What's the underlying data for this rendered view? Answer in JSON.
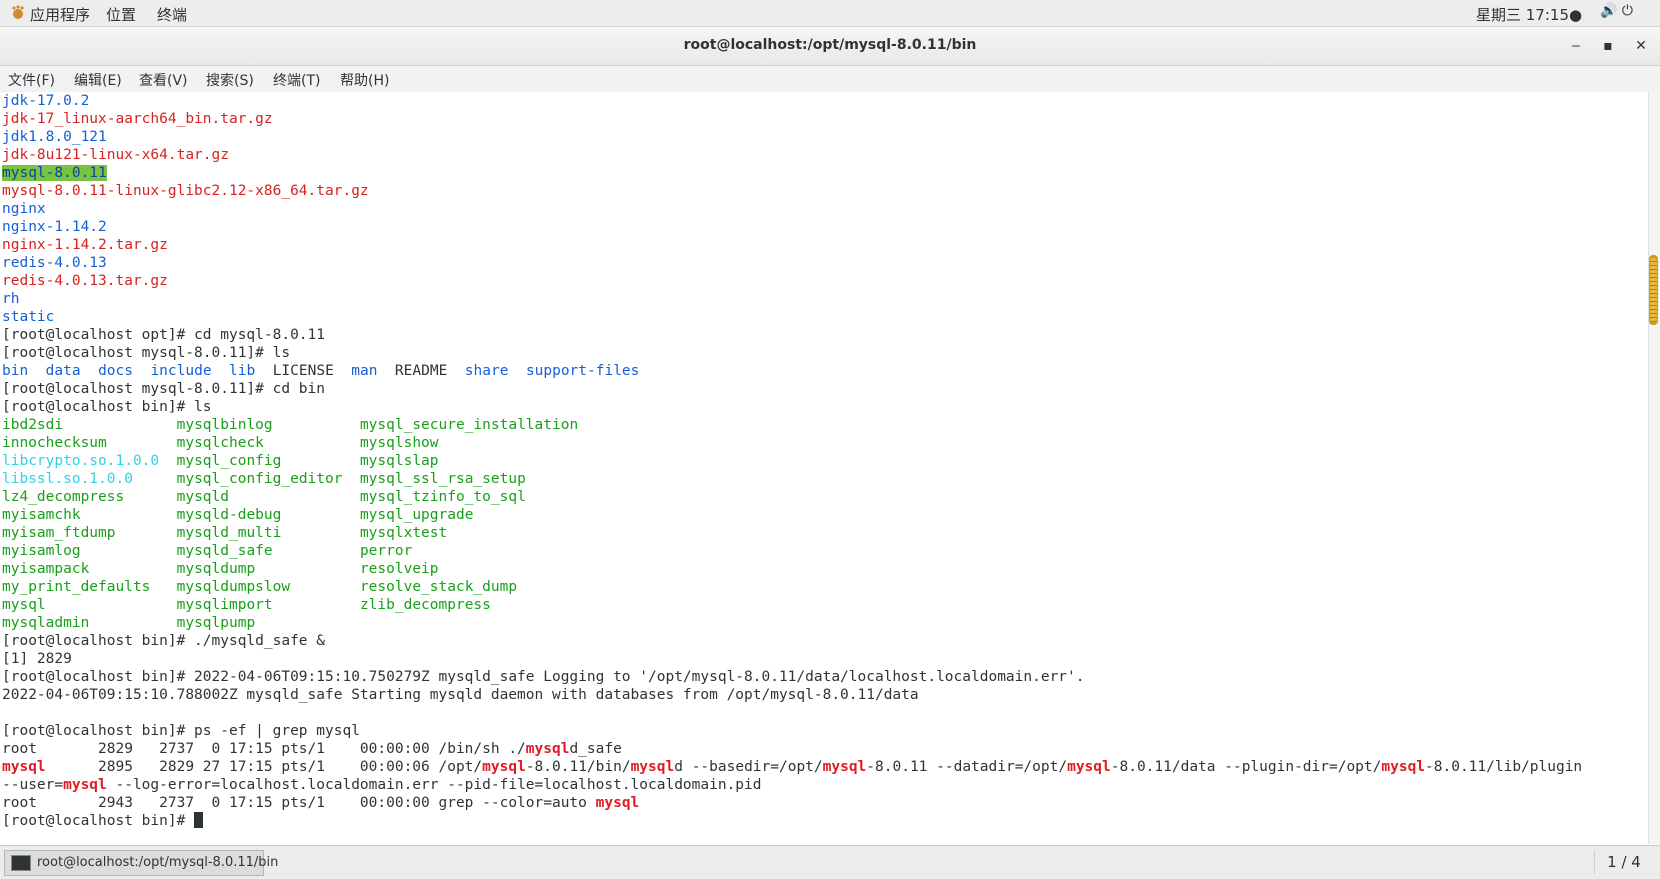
{
  "topbar": {
    "menu": [
      "应用程序",
      "位置",
      "终端"
    ],
    "clock": "星期三 17:15●",
    "status_icons": "🔊 ⏻"
  },
  "window": {
    "title": "root@localhost:/opt/mysql-8.0.11/bin",
    "minimize": "‒",
    "maximize": "▪",
    "close": "✕"
  },
  "menubar": [
    "文件(F)",
    "编辑(E)",
    "查看(V)",
    "搜索(S)",
    "终端(T)",
    "帮助(H)"
  ],
  "terminal": {
    "lines": [
      [
        {
          "t": "jdk-17.0.2",
          "c": "blue"
        }
      ],
      [
        {
          "t": "jdk-17_linux-aarch64_bin.tar.gz",
          "c": "red"
        }
      ],
      [
        {
          "t": "jdk1.8.0_121",
          "c": "blue"
        }
      ],
      [
        {
          "t": "jdk-8u121-linux-x64.tar.gz",
          "c": "red"
        }
      ],
      [
        {
          "t": "mysql-8.0.11",
          "c": "hl"
        }
      ],
      [
        {
          "t": "mysql-8.0.11-linux-glibc2.12-x86_64.tar.gz",
          "c": "red"
        }
      ],
      [
        {
          "t": "nginx",
          "c": "blue"
        }
      ],
      [
        {
          "t": "nginx-1.14.2",
          "c": "blue"
        }
      ],
      [
        {
          "t": "nginx-1.14.2.tar.gz",
          "c": "red"
        }
      ],
      [
        {
          "t": "redis-4.0.13",
          "c": "blue"
        }
      ],
      [
        {
          "t": "redis-4.0.13.tar.gz",
          "c": "red"
        }
      ],
      [
        {
          "t": "rh",
          "c": "blue"
        }
      ],
      [
        {
          "t": "static",
          "c": "blue"
        }
      ],
      [
        {
          "t": "[root@localhost opt]# cd mysql-8.0.11"
        }
      ],
      [
        {
          "t": "[root@localhost mysql-8.0.11]# ls"
        }
      ],
      [
        {
          "t": "bin",
          "c": "blue"
        },
        {
          "t": "  "
        },
        {
          "t": "data",
          "c": "blue"
        },
        {
          "t": "  "
        },
        {
          "t": "docs",
          "c": "blue"
        },
        {
          "t": "  "
        },
        {
          "t": "include",
          "c": "blue"
        },
        {
          "t": "  "
        },
        {
          "t": "lib",
          "c": "blue"
        },
        {
          "t": "  LICENSE  "
        },
        {
          "t": "man",
          "c": "blue"
        },
        {
          "t": "  README  "
        },
        {
          "t": "share",
          "c": "blue"
        },
        {
          "t": "  "
        },
        {
          "t": "support-files",
          "c": "blue"
        }
      ],
      [
        {
          "t": "[root@localhost mysql-8.0.11]# cd bin"
        }
      ],
      [
        {
          "t": "[root@localhost bin]# ls"
        }
      ],
      [
        {
          "t": "ibd2sdi             ",
          "c": "green"
        },
        {
          "t": "mysqlbinlog          ",
          "c": "green"
        },
        {
          "t": "mysql_secure_installation",
          "c": "green"
        }
      ],
      [
        {
          "t": "innochecksum        ",
          "c": "green"
        },
        {
          "t": "mysqlcheck           ",
          "c": "green"
        },
        {
          "t": "mysqlshow",
          "c": "green"
        }
      ],
      [
        {
          "t": "libcrypto.so.1.0.0",
          "c": "cyan"
        },
        {
          "t": "  "
        },
        {
          "t": "mysql_config         ",
          "c": "green"
        },
        {
          "t": "mysqlslap",
          "c": "green"
        }
      ],
      [
        {
          "t": "libssl.so.1.0.0",
          "c": "cyan"
        },
        {
          "t": "     "
        },
        {
          "t": "mysql_config_editor  ",
          "c": "green"
        },
        {
          "t": "mysql_ssl_rsa_setup",
          "c": "green"
        }
      ],
      [
        {
          "t": "lz4_decompress      ",
          "c": "green"
        },
        {
          "t": "mysqld               ",
          "c": "green"
        },
        {
          "t": "mysql_tzinfo_to_sql",
          "c": "green"
        }
      ],
      [
        {
          "t": "myisamchk           ",
          "c": "green"
        },
        {
          "t": "mysqld-debug         ",
          "c": "green"
        },
        {
          "t": "mysql_upgrade",
          "c": "green"
        }
      ],
      [
        {
          "t": "myisam_ftdump       ",
          "c": "green"
        },
        {
          "t": "mysqld_multi         ",
          "c": "green"
        },
        {
          "t": "mysqlxtest",
          "c": "green"
        }
      ],
      [
        {
          "t": "myisamlog           ",
          "c": "green"
        },
        {
          "t": "mysqld_safe          ",
          "c": "green"
        },
        {
          "t": "perror",
          "c": "green"
        }
      ],
      [
        {
          "t": "myisampack          ",
          "c": "green"
        },
        {
          "t": "mysqldump            ",
          "c": "green"
        },
        {
          "t": "resolveip",
          "c": "green"
        }
      ],
      [
        {
          "t": "my_print_defaults   ",
          "c": "green"
        },
        {
          "t": "mysqldumpslow        ",
          "c": "green"
        },
        {
          "t": "resolve_stack_dump",
          "c": "green"
        }
      ],
      [
        {
          "t": "mysql               ",
          "c": "green"
        },
        {
          "t": "mysqlimport          ",
          "c": "green"
        },
        {
          "t": "zlib_decompress",
          "c": "green"
        }
      ],
      [
        {
          "t": "mysqladmin          ",
          "c": "green"
        },
        {
          "t": "mysqlpump",
          "c": "green"
        }
      ],
      [
        {
          "t": "[root@localhost bin]# ./mysqld_safe &"
        }
      ],
      [
        {
          "t": "[1] 2829"
        }
      ],
      [
        {
          "t": "[root@localhost bin]# 2022-04-06T09:15:10.750279Z mysqld_safe Logging to '/opt/mysql-8.0.11/data/localhost.localdomain.err'."
        }
      ],
      [
        {
          "t": "2022-04-06T09:15:10.788002Z mysqld_safe Starting mysqld daemon with databases from /opt/mysql-8.0.11/data"
        }
      ],
      [
        {
          "t": ""
        }
      ],
      [
        {
          "t": "[root@localhost bin]# ps -ef | grep mysql"
        }
      ],
      [
        {
          "t": "root       2829   2737  0 17:15 pts/1    00:00:00 /bin/sh ./"
        },
        {
          "t": "mysql",
          "c": "br"
        },
        {
          "t": "d_safe"
        }
      ],
      [
        {
          "t": "mysql",
          "c": "br"
        },
        {
          "t": "      2895   2829 27 17:15 pts/1    00:00:06 /opt/"
        },
        {
          "t": "mysql",
          "c": "br"
        },
        {
          "t": "-8.0.11/bin/"
        },
        {
          "t": "mysql",
          "c": "br"
        },
        {
          "t": "d --basedir=/opt/"
        },
        {
          "t": "mysql",
          "c": "br"
        },
        {
          "t": "-8.0.11 --datadir=/opt/"
        },
        {
          "t": "mysql",
          "c": "br"
        },
        {
          "t": "-8.0.11/data --plugin-dir=/opt/"
        },
        {
          "t": "mysql",
          "c": "br"
        },
        {
          "t": "-8.0.11/lib/plugin"
        }
      ],
      [
        {
          "t": "--user="
        },
        {
          "t": "mysql",
          "c": "br"
        },
        {
          "t": " --log-error=localhost.localdomain.err --pid-file=localhost.localdomain.pid"
        }
      ],
      [
        {
          "t": "root       2943   2737  0 17:15 pts/1    00:00:00 grep --color=auto "
        },
        {
          "t": "mysql",
          "c": "br"
        }
      ],
      [
        {
          "t": "[root@localhost bin]# "
        },
        {
          "t": "",
          "c": "cursor"
        }
      ]
    ]
  },
  "taskbar": {
    "task_label": "root@localhost:/opt/mysql-8.0.11/bin",
    "workspace": "1 / 4"
  },
  "colors": {
    "blue": "#1560d4",
    "red": "#d92121",
    "green": "#19a019",
    "cyan": "#2fd3e6",
    "highlight_bg": "#76c442",
    "match_red": "#e01b24"
  }
}
